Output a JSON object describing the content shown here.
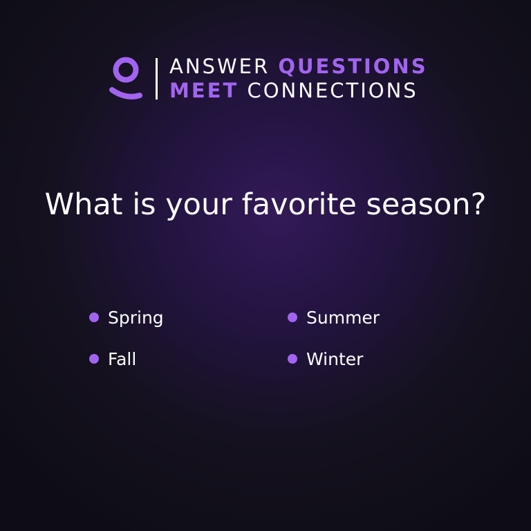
{
  "brand": {
    "line1_word1": "ANSWER",
    "line1_word2": "QUESTIONS",
    "line2_word1": "MEET",
    "line2_word2": "CONNECTIONS",
    "accent_color": "#a264f0",
    "logo_icon": "person-icon"
  },
  "question": "What is your favorite season?",
  "options": [
    {
      "label": "Spring"
    },
    {
      "label": "Summer"
    },
    {
      "label": "Fall"
    },
    {
      "label": "Winter"
    }
  ]
}
